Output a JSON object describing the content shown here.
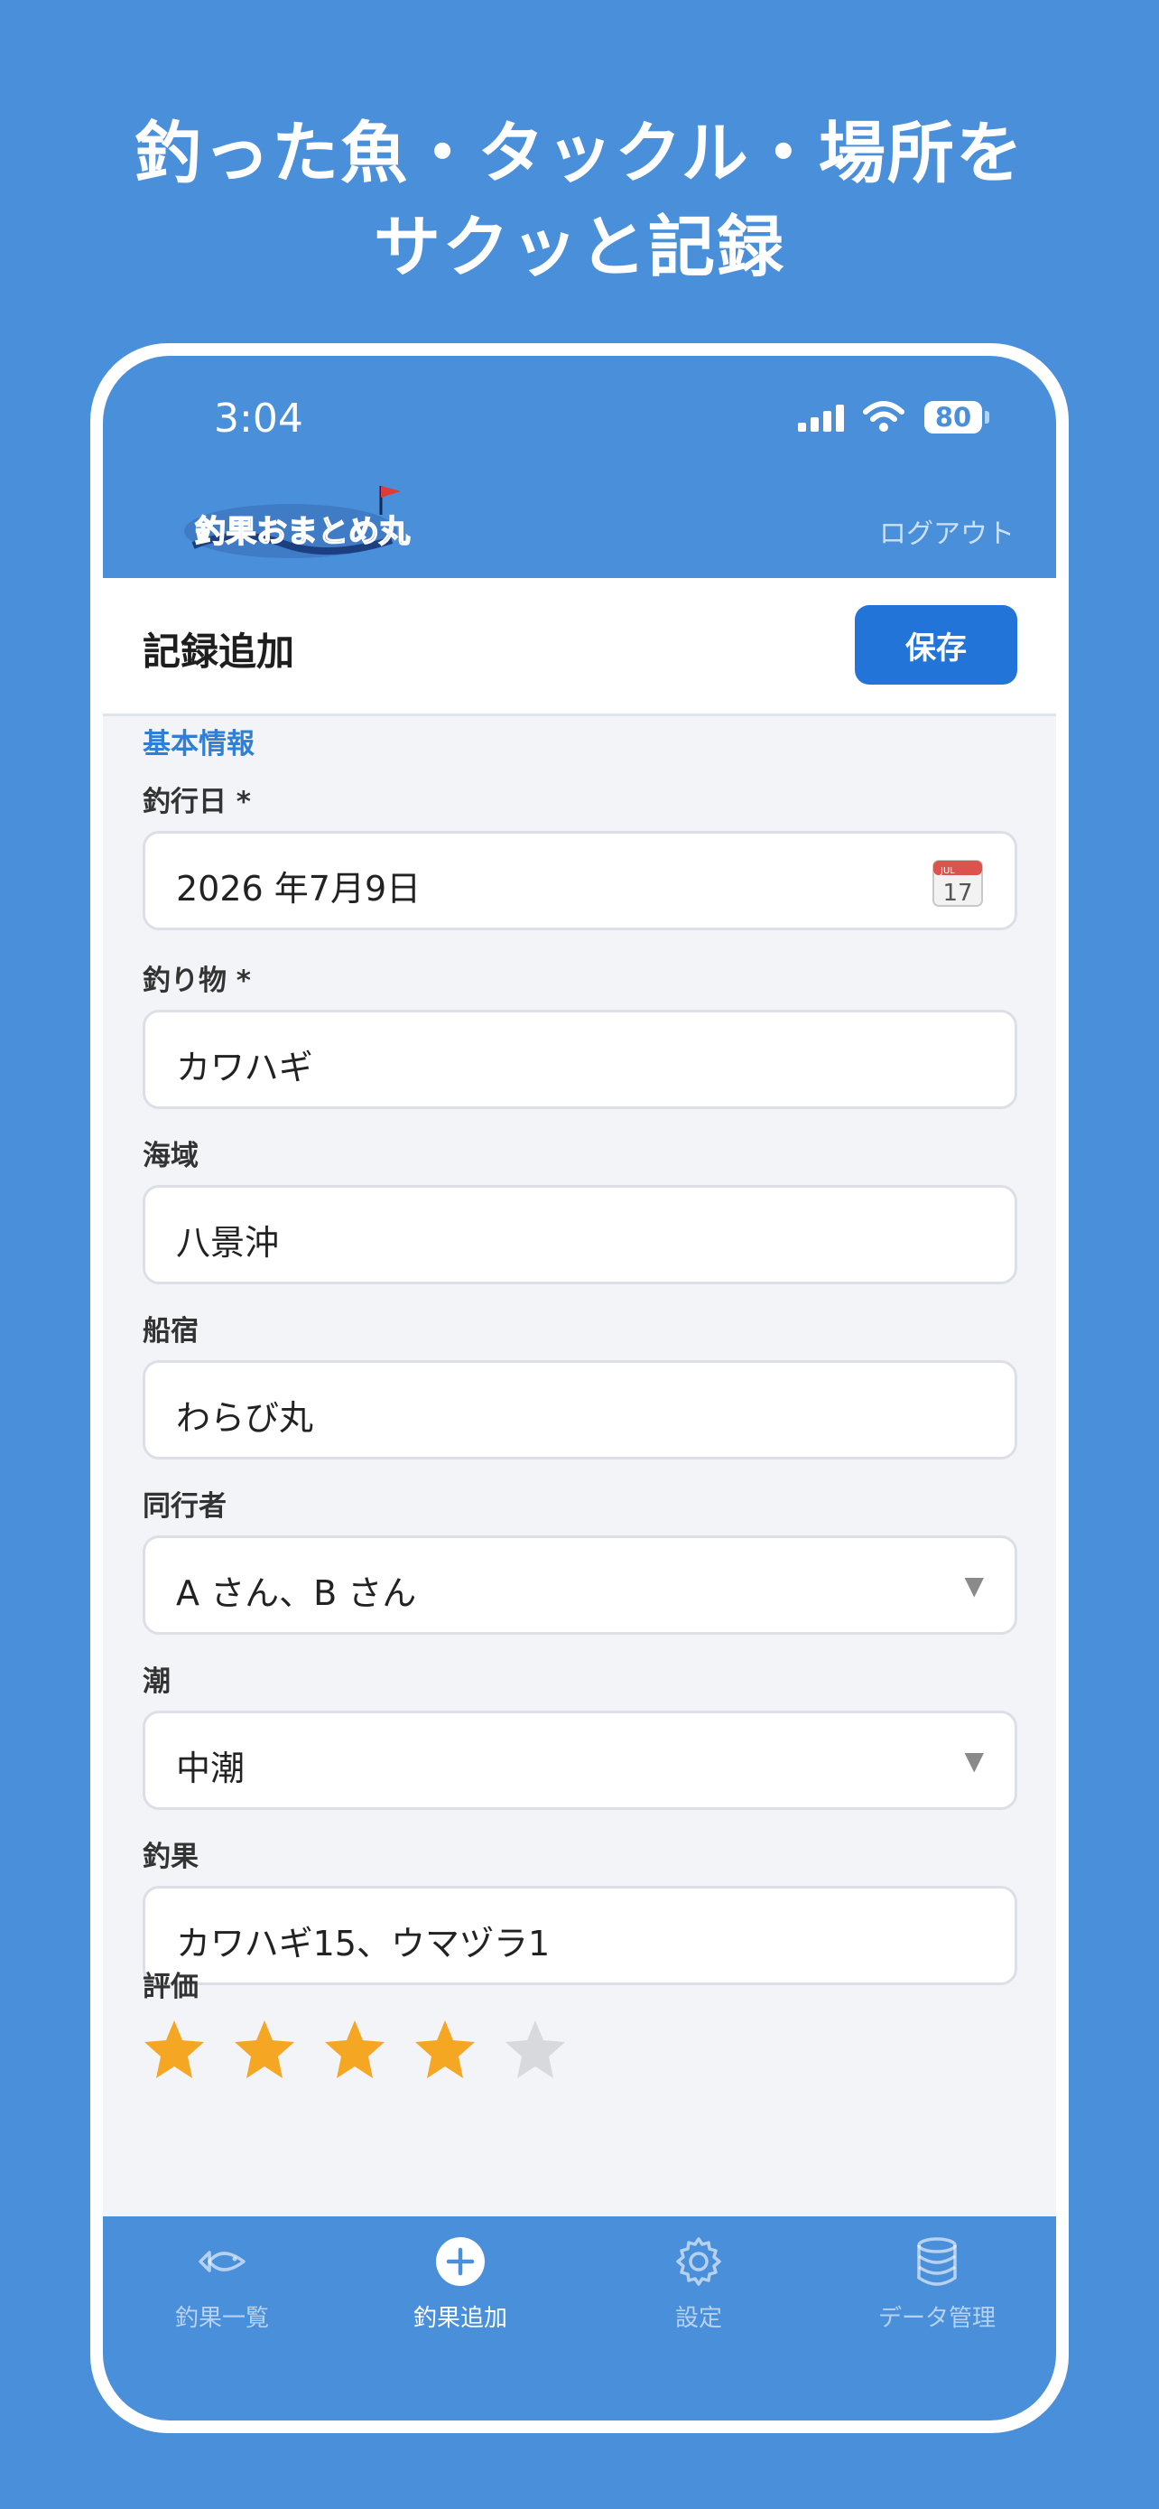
{
  "headline": {
    "line1": "釣った魚・タックル・場所を",
    "line2": "サクッと記録"
  },
  "status_bar": {
    "time": "3:04",
    "battery": "80"
  },
  "app_header": {
    "logo_text": "釣果おまとめ丸",
    "logout_label": "ログアウト"
  },
  "title_bar": {
    "title": "記録追加",
    "save_label": "保存"
  },
  "form": {
    "section_title": "基本情報",
    "fields": [
      {
        "label": "釣行日 *",
        "value": "2026 年7月9日",
        "icon": "calendar-icon"
      },
      {
        "label": "釣り物 *",
        "value": "カワハギ"
      },
      {
        "label": "海域",
        "value": "八景沖"
      },
      {
        "label": "船宿",
        "value": "わらび丸"
      },
      {
        "label": "同行者",
        "value": "A さん、B さん",
        "icon": "dropdown-caret-icon"
      },
      {
        "label": "潮",
        "value": "中潮",
        "icon": "dropdown-caret-icon"
      },
      {
        "label": "釣果",
        "value": "カワハギ15、ウマヅラ1"
      }
    ],
    "rating_label": "評価",
    "rating_value": 4,
    "rating_max": 5,
    "calendar_day": "17",
    "calendar_month": "JUL"
  },
  "tab_bar": {
    "tabs": [
      {
        "label": "釣果一覧",
        "icon": "fish-icon",
        "active": false
      },
      {
        "label": "釣果追加",
        "icon": "plus-circle-icon",
        "active": true
      },
      {
        "label": "設定",
        "icon": "gear-icon",
        "active": false
      },
      {
        "label": "データ管理",
        "icon": "database-icon",
        "active": false
      }
    ]
  },
  "colors": {
    "background": "#4a8fd9",
    "accent": "#2374d9",
    "section_title": "#2f7fd6",
    "star_filled": "#f5a623",
    "star_empty": "#d7d9dd"
  }
}
